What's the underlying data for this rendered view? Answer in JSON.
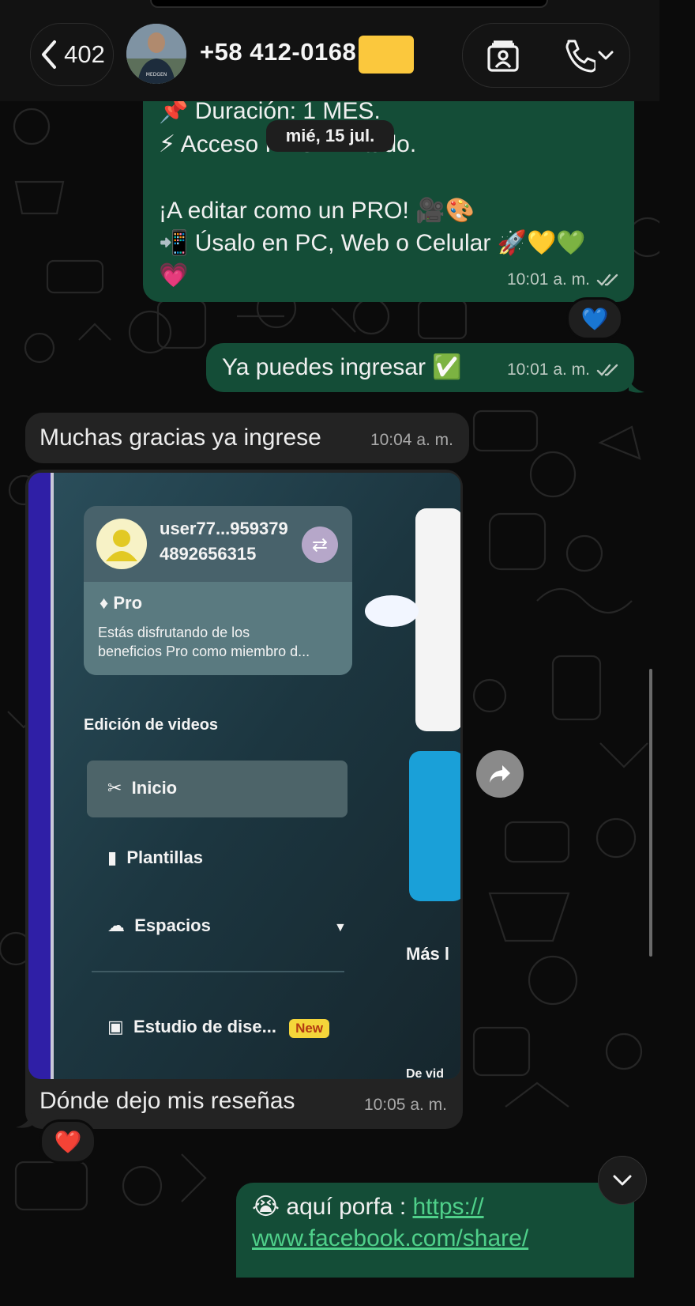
{
  "header": {
    "back_count": "402",
    "contact_name": "+58 412-0168",
    "avatar_label": "MEDGEN"
  },
  "chat": {
    "date_chip": "mié, 15 jul.",
    "msg1": {
      "line1": "📌 Duración: 1 MES.",
      "line2": "⚡ Acceso PRO ilimitado.",
      "line3": "¡A editar como un PRO! 🎥🎨",
      "line4": "📲 Úsalo en PC, Web o Celular 🚀💛💚",
      "line5": "💗",
      "time": "10:01 a. m.",
      "reaction": "💙"
    },
    "msg2": {
      "text": "Ya puedes ingresar ✅",
      "time": "10:01 a. m."
    },
    "msg3": {
      "text": "Muchas gracias ya ingrese",
      "time": "10:04 a. m."
    },
    "msg4": {
      "caption": "Dónde dejo mis reseñas",
      "time": "10:05 a. m.",
      "reaction": "❤️",
      "photo": {
        "username": "user77...959379",
        "user_id": "4892656315",
        "plan": "Pro",
        "plan_desc_1": "Estás disfrutando de los",
        "plan_desc_2": "beneficios Pro como miembro d...",
        "section": "Edición de videos",
        "menu": [
          "Inicio",
          "Plantillas",
          "Espacios",
          "Estudio de dise..."
        ],
        "new_badge": "New",
        "more": "Más l",
        "bottom_cut": "De vid"
      }
    },
    "msg5": {
      "prefix": "😭 aquí porfa : ",
      "link1": "https://",
      "link2": "www.facebook.com/share/"
    }
  },
  "colors": {
    "outgoing": "#144d37",
    "incoming": "#232323",
    "link": "#4fd08a",
    "redaction": "#fbc83d"
  },
  "icons": [
    "chevron-left-icon",
    "contact-card-icon",
    "phone-icon",
    "chevron-down-icon",
    "double-check-icon",
    "forward-icon",
    "scroll-down-icon"
  ]
}
